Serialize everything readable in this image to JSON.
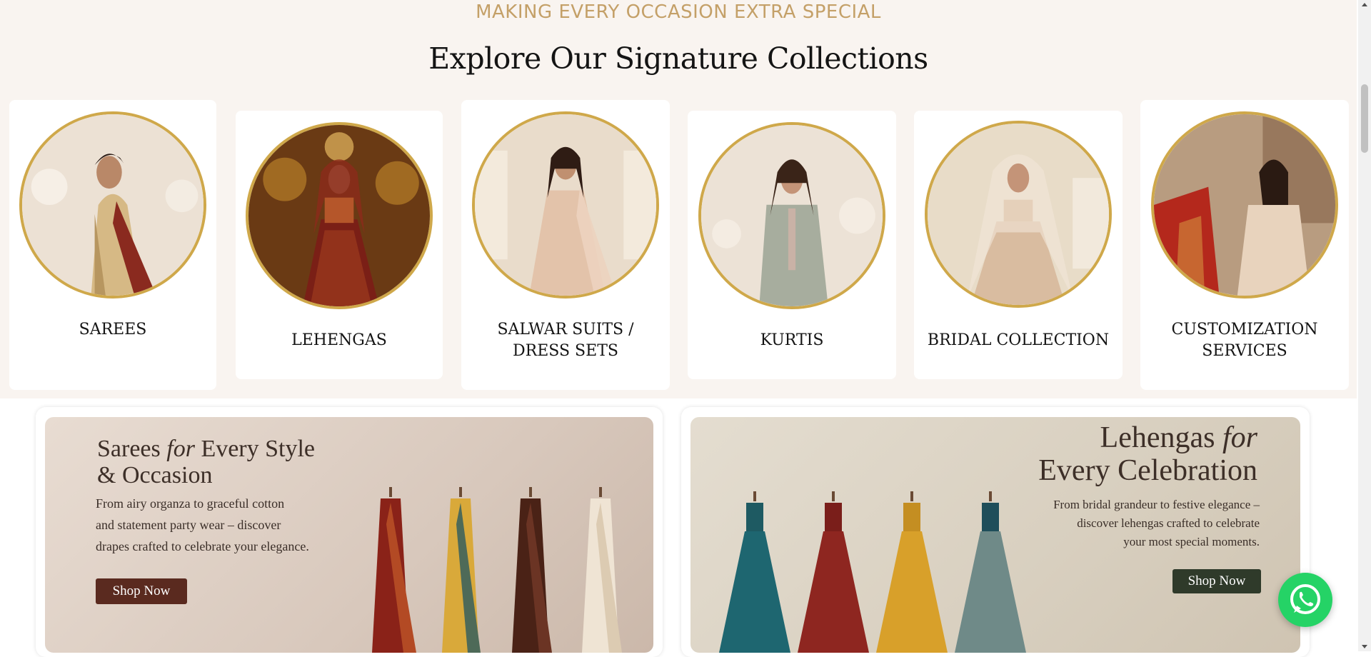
{
  "section": {
    "eyebrow": "MAKING EVERY OCCASION EXTRA SPECIAL",
    "title": "Explore Our Signature Collections"
  },
  "collections": [
    {
      "label": "SAREES"
    },
    {
      "label": "LEHENGAS"
    },
    {
      "label": "SALWAR SUITS / DRESS SETS"
    },
    {
      "label": "KURTIS"
    },
    {
      "label": "BRIDAL COLLECTION"
    },
    {
      "label": "CUSTOMIZATION SERVICES"
    }
  ],
  "banners": {
    "sarees": {
      "title_pre": "Sarees ",
      "title_em": "for",
      "title_post": " Every Style",
      "title_line2": "& Occasion",
      "text_line1": "From airy organza to graceful cotton",
      "text_line2": "and statement party wear – discover",
      "text_line3": "drapes crafted to celebrate your elegance.",
      "button": "Shop Now"
    },
    "lehengas": {
      "title_pre": "Lehengas ",
      "title_em": "for",
      "title_line2": "Every Celebration",
      "text_line1": "From bridal grandeur to festive elegance –",
      "text_line2": "discover lehengas crafted to celebrate",
      "text_line3": "your most special moments.",
      "button": "Shop Now"
    }
  },
  "colors": {
    "accent_gold": "#c4a068",
    "circle_border": "#cfa84a",
    "sarees_button": "#5a2a1f",
    "lehengas_button": "#2f3a2a",
    "whatsapp": "#25d366"
  },
  "icons": {
    "whatsapp": "whatsapp-icon"
  }
}
